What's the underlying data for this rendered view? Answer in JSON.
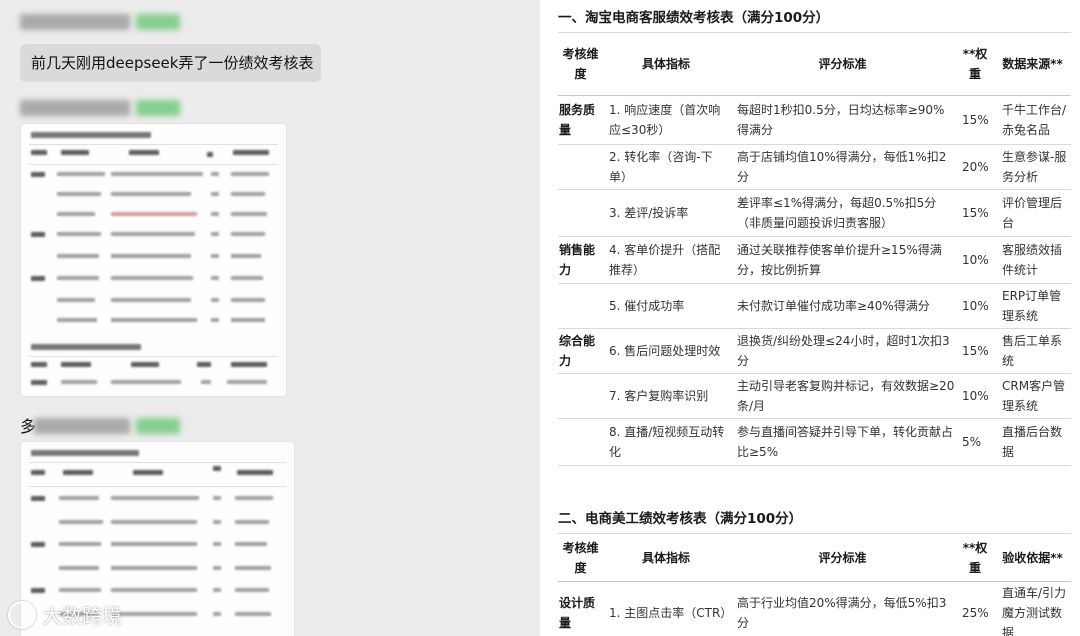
{
  "chat": {
    "bubble_text": "前几天刚用deepseek弄了一份绩效考核表",
    "partial_char": "多",
    "watermark": "大数跨境"
  },
  "doc": {
    "section1": {
      "title": "一、淘宝电商客服绩效考核表（满分100分）",
      "headers": [
        "考核维度",
        "具体指标",
        "评分标准",
        "**权重",
        "数据来源**"
      ],
      "rows": [
        {
          "dim": "服务质量",
          "indicator": "1. 响应速度（首次响应≤30秒）",
          "standard": "每超时1秒扣0.5分，日均达标率≥90%得满分",
          "weight": "15%",
          "source": "千牛工作台/赤兔名品"
        },
        {
          "dim": "",
          "indicator": "2. 转化率（咨询-下单）",
          "standard": "高于店铺均值10%得满分，每低1%扣2分",
          "weight": "20%",
          "source": "生意参谋-服务分析"
        },
        {
          "dim": "",
          "indicator": "3. 差评/投诉率",
          "standard": "差评率≤1%得满分，每超0.5%扣5分（非质量问题投诉归责客服）",
          "weight": "15%",
          "source": "评价管理后台"
        },
        {
          "dim": "销售能力",
          "indicator": "4. 客单价提升（搭配推荐）",
          "standard": "通过关联推荐使客单价提升≥15%得满分，按比例折算",
          "weight": "10%",
          "source": "客服绩效插件统计"
        },
        {
          "dim": "",
          "indicator": "5. 催付成功率",
          "standard": "未付款订单催付成功率≥40%得满分",
          "weight": "10%",
          "source": "ERP订单管理系统"
        },
        {
          "dim": "综合能力",
          "indicator": "6. 售后问题处理时效",
          "standard": "退换货/纠纷处理≤24小时，超时1次扣3分",
          "weight": "15%",
          "source": "售后工单系统"
        },
        {
          "dim": "",
          "indicator": "7. 客户复购率识别",
          "standard": "主动引导老客复购并标记，有效数据≥20条/月",
          "weight": "10%",
          "source": "CRM客户管理系统"
        },
        {
          "dim": "",
          "indicator": "8. 直播/短视频互动转化",
          "standard": "参与直播间答疑并引导下单，转化贡献占比≥5%",
          "weight": "5%",
          "source": "直播后台数据"
        }
      ]
    },
    "section2": {
      "title": "二、电商美工绩效考核表（满分100分）",
      "headers": [
        "考核维度",
        "具体指标",
        "评分标准",
        "**权重",
        "验收依据**"
      ],
      "rows": [
        {
          "dim": "设计质量",
          "indicator": "1. 主图点击率（CTR）",
          "standard": "高于行业均值20%得满分，每低5%扣3分",
          "weight": "25%",
          "source": "直通车/引力魔方测试数据"
        }
      ]
    }
  }
}
